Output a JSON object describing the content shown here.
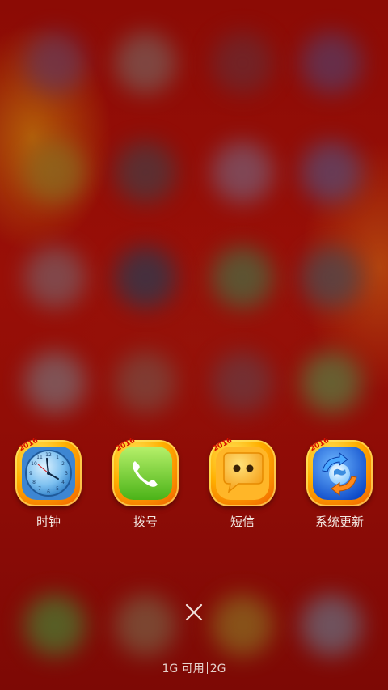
{
  "dock": {
    "apps": [
      {
        "label": "时钟",
        "icon": "clock-icon",
        "badge": "2016"
      },
      {
        "label": "拨号",
        "icon": "phone-icon",
        "badge": "2016"
      },
      {
        "label": "短信",
        "icon": "message-icon",
        "badge": "2016"
      },
      {
        "label": "系统更新",
        "icon": "system-update-icon",
        "badge": "2016"
      }
    ]
  },
  "memory": {
    "available": "1G 可用",
    "total": "2G"
  },
  "colors": {
    "background": "#8f0c06",
    "icon_frame": "#ff9a00",
    "label_text": "#f2e6e0"
  }
}
